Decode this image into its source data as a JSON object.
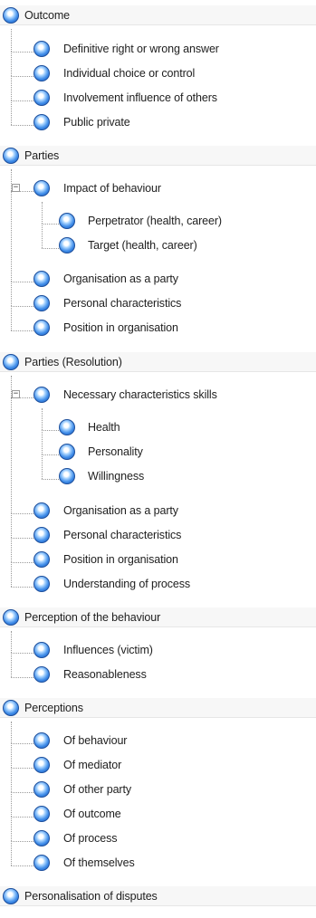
{
  "tree": {
    "items": [
      {
        "label": "Outcome",
        "level": 0
      },
      {
        "label": "Definitive right or wrong answer",
        "level": 1
      },
      {
        "label": "Individual choice or control",
        "level": 1
      },
      {
        "label": "Involvement influence of others",
        "level": 1
      },
      {
        "label": "Public private",
        "level": 1
      },
      {
        "label": "Parties",
        "level": 0
      },
      {
        "label": "Impact of behaviour",
        "level": 1,
        "expander": "−"
      },
      {
        "label": "Perpetrator (health, career)",
        "level": 2
      },
      {
        "label": "Target (health, career)",
        "level": 2
      },
      {
        "label": "Organisation as a party",
        "level": 1
      },
      {
        "label": "Personal characteristics",
        "level": 1
      },
      {
        "label": "Position in organisation",
        "level": 1
      },
      {
        "label": "Parties (Resolution)",
        "level": 0
      },
      {
        "label": "Necessary characteristics skills",
        "level": 1,
        "expander": "−"
      },
      {
        "label": "Health",
        "level": 2
      },
      {
        "label": "Personality",
        "level": 2
      },
      {
        "label": "Willingness",
        "level": 2
      },
      {
        "label": "Organisation as a party",
        "level": 1
      },
      {
        "label": "Personal characteristics",
        "level": 1
      },
      {
        "label": "Position in organisation",
        "level": 1
      },
      {
        "label": "Understanding of process",
        "level": 1
      },
      {
        "label": "Perception of the behaviour",
        "level": 0
      },
      {
        "label": "Influences (victim)",
        "level": 1
      },
      {
        "label": "Reasonableness",
        "level": 1
      },
      {
        "label": "Perceptions",
        "level": 0
      },
      {
        "label": "Of behaviour",
        "level": 1
      },
      {
        "label": "Of mediator",
        "level": 1
      },
      {
        "label": "Of other party",
        "level": 1
      },
      {
        "label": "Of outcome",
        "level": 1
      },
      {
        "label": "Of process",
        "level": 1
      },
      {
        "label": "Of themselves",
        "level": 1
      },
      {
        "label": "Personalisation of disputes",
        "level": 0
      }
    ]
  }
}
